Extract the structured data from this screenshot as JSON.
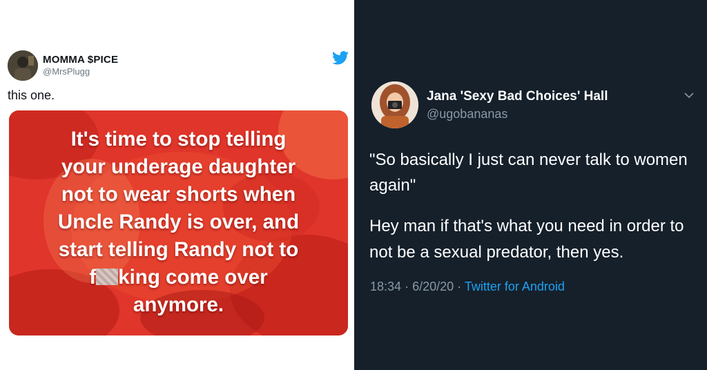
{
  "left_tweet": {
    "display_name": "MOMMA $PICE",
    "handle": "@MrsPlugg",
    "text": "this one.",
    "icon": "twitter-bird-icon",
    "meme": {
      "line1": "It's time to stop telling",
      "line2": "your underage daughter",
      "line3": "not to wear shorts when",
      "line4": "Uncle Randy is over, and",
      "line5": "start telling Randy not to",
      "line6_prefix": "f",
      "line6_suffix": "king come over",
      "line7": "anymore."
    }
  },
  "right_tweet": {
    "display_name": "Jana 'Sexy Bad Choices' Hall",
    "handle": "@ugobananas",
    "quote": "\"So basically I just can never talk to women again\"",
    "reply": "Hey man if that's what you need in order to not be a sexual predator, then yes.",
    "time": "18:34",
    "sep1": "·",
    "date": "6/20/20",
    "sep2": "·",
    "source": "Twitter for Android",
    "menu_icon": "chevron-down-icon"
  },
  "colors": {
    "twitter_blue": "#1da1f2",
    "dark_bg": "#15202b",
    "meme_red": "#e23a2c"
  }
}
